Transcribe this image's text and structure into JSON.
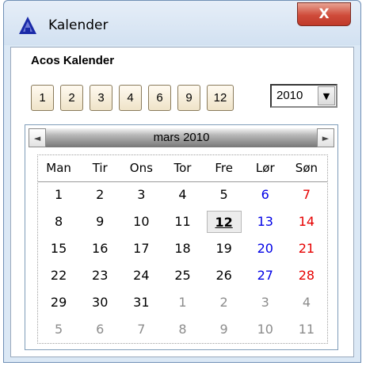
{
  "window": {
    "title": "Kalender",
    "close_label": "X"
  },
  "panel": {
    "heading": "Acos Kalender"
  },
  "month_buttons": [
    "1",
    "2",
    "3",
    "4",
    "6",
    "9",
    "12"
  ],
  "year_select": {
    "value": "2010"
  },
  "calendar": {
    "month_label": "mars 2010",
    "prev_arrow": "◄",
    "next_arrow": "►",
    "weekdays": [
      "Man",
      "Tir",
      "Ons",
      "Tor",
      "Fre",
      "Lør",
      "Søn"
    ],
    "weeks": [
      [
        "1",
        "2",
        "3",
        "4",
        "5",
        "6",
        "7"
      ],
      [
        "8",
        "9",
        "10",
        "11",
        "12",
        "13",
        "14"
      ],
      [
        "15",
        "16",
        "17",
        "18",
        "19",
        "20",
        "21"
      ],
      [
        "22",
        "23",
        "24",
        "25",
        "26",
        "27",
        "28"
      ],
      [
        "29",
        "30",
        "31",
        "1",
        "2",
        "3",
        "4"
      ],
      [
        "5",
        "6",
        "7",
        "8",
        "9",
        "10",
        "11"
      ]
    ],
    "today": "12",
    "colors": {
      "saturday": "#0000e6",
      "sunday": "#e60000",
      "other_month": "#8c8c8c"
    }
  }
}
